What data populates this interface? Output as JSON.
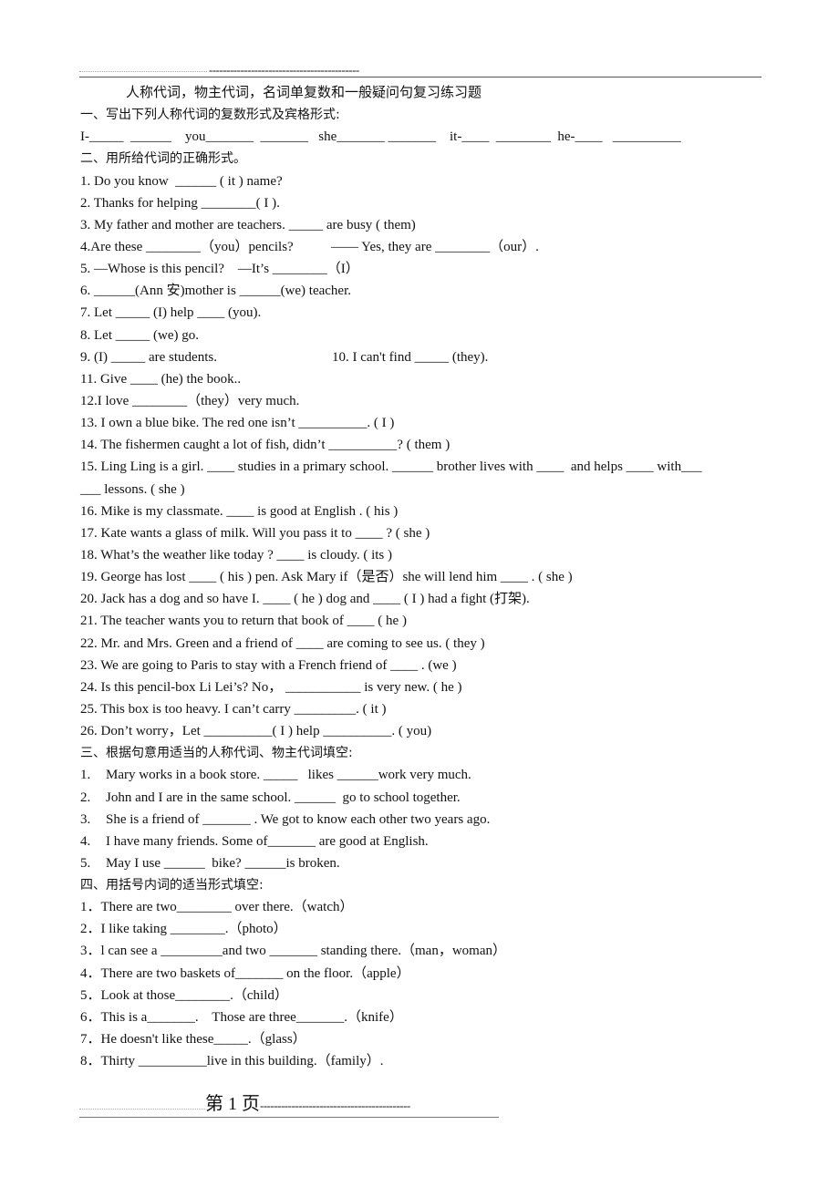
{
  "header": {
    "dashes": "-------------------------------------------"
  },
  "document": {
    "title": "人称代词，物主代词，名词单复数和一般疑问句复习练习题",
    "section1": {
      "heading": "一、写出下列人称代词的复数形式及宾格形式:",
      "line": "I-_____  ______    you_______  _______   she_______ _______    it-____  ________  he-____   __________"
    },
    "section2": {
      "heading": "二、用所给代词的正确形式。",
      "items": [
        "1. Do you know  ______ ( it ) name?",
        "2. Thanks for helping ________( I ).",
        "3. My father and mother are teachers. _____ are busy ( them)",
        "4.Are these ________（you）pencils?           —— Yes, they are ________（our）.",
        "5. —Whose is this pencil?    —It’s ________（I）",
        "6. ______(Ann 安)mother is ______(we) teacher.",
        "7. Let _____ (I) help ____ (you).",
        "8. Let _____ (we) go.",
        "9. (I) _____ are students.",
        "10. I can't find _____ (they).",
        "11. Give ____ (he) the book..",
        "12.I love ________（they）very much.",
        "13. I own a blue bike. The red one isn’t __________. ( I )",
        "14. The fishermen caught a lot of fish, didn’t __________? ( them )",
        "15. Ling Ling is a girl. ____ studies in a primary school. ______ brother lives with ____  and helps ____ with___",
        "___ lessons. ( she )",
        "16. Mike is my classmate. ____ is good at English . ( his )",
        "17. Kate wants a glass of milk. Will you pass it to ____ ? ( she )",
        "18. What’s the weather like today ? ____ is cloudy. ( its )",
        "19. George has lost ____ ( his ) pen. Ask Mary if（是否）she will lend him ____ . ( she )",
        "20. Jack has a dog and so have I. ____ ( he ) dog and ____ ( I ) had a fight (打架).",
        "21. The teacher wants you to return that book of ____ ( he )",
        "22. Mr. and Mrs. Green and a friend of ____ are coming to see us. ( they )",
        "23. We are going to Paris to stay with a French friend of ____ . (we )",
        "24. Is this pencil-box Li Lei’s? No， ___________ is very new. ( he )",
        "25. This box is too heavy. I can’t carry _________. ( it )",
        "26. Don’t worry，Let __________( I ) help __________. ( you)"
      ]
    },
    "section3": {
      "heading": "三、根据句意用适当的人称代词、物主代词填空:",
      "items": [
        {
          "num": "1.",
          "text": "Mary works in a book store. _____   likes ______work very much."
        },
        {
          "num": "2.",
          "text": "John and I are in the same school. ______  go to school together."
        },
        {
          "num": "3.",
          "text": "She is a friend of _______ . We got to know each other two years ago."
        },
        {
          "num": "4.",
          "text": "I have many friends. Some of_______ are good at English."
        },
        {
          "num": "5.",
          "text": "May I use ______  bike? ______is broken."
        }
      ]
    },
    "section4": {
      "heading": "四、用括号内词的适当形式填空:",
      "items": [
        "1．There are two________ over there.（watch）",
        "2．I like taking ________.（photo）",
        "3．l can see a _________and two _______ standing there.（man，woman）",
        "4．There are two baskets of_______ on the floor.（apple）",
        "5．Look at those________.（child）",
        "6．This is a_______.    Those are three_______.（knife）",
        "7．He doesn't like these_____.（glass）",
        "8．Thirty __________live in this building.（family）."
      ]
    }
  },
  "footer": {
    "page_label": "第 1 页",
    "dashes": "-------------------------------------------"
  }
}
